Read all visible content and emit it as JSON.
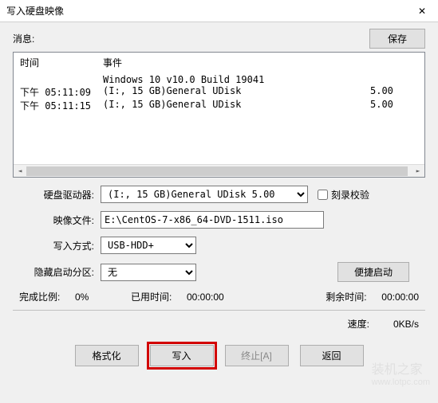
{
  "title": "写入硬盘映像",
  "topbar": {
    "info_label": "消息:",
    "save_btn": "保存"
  },
  "log": {
    "header_time": "时间",
    "header_event": "事件",
    "rows": [
      {
        "time": "",
        "event": "Windows 10 v10.0 Build 19041",
        "val": ""
      },
      {
        "time": "下午 05:11:09",
        "event": "(I:, 15 GB)General UDisk",
        "val": "5.00"
      },
      {
        "time": "下午 05:11:15",
        "event": "(I:, 15 GB)General UDisk",
        "val": "5.00"
      }
    ]
  },
  "form": {
    "drive_label": "硬盘驱动器:",
    "drive_value": "(I:, 15 GB)General UDisk      5.00",
    "verify_label": "刻录校验",
    "image_label": "映像文件:",
    "image_value": "E:\\CentOS-7-x86_64-DVD-1511.iso",
    "write_mode_label": "写入方式:",
    "write_mode_value": "USB-HDD+",
    "hidden_boot_label": "隐藏启动分区:",
    "hidden_boot_value": "无",
    "convenient_boot_btn": "便捷启动"
  },
  "progress": {
    "complete_label": "完成比例:",
    "complete_value": "0%",
    "elapsed_label": "已用时间:",
    "elapsed_value": "00:00:00",
    "remain_label": "剩余时间:",
    "remain_value": "00:00:00",
    "speed_label": "速度:",
    "speed_value": "0KB/s"
  },
  "buttons": {
    "format": "格式化",
    "write": "写入",
    "abort": "终止[A]",
    "back": "返回"
  },
  "watermark": {
    "text": "装机之家",
    "url": "www.lotpc.com"
  }
}
